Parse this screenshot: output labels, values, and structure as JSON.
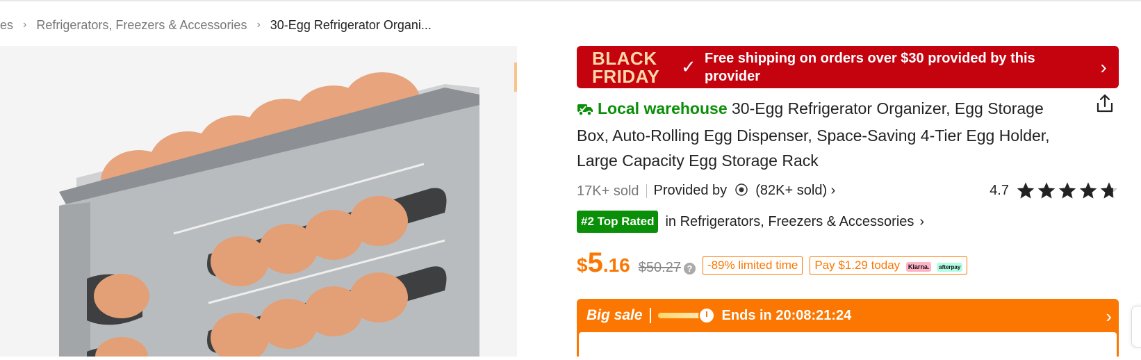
{
  "breadcrumb": {
    "items": [
      "es",
      "Refrigerators, Freezers & Accessories",
      "30-Egg Refrigerator Organi..."
    ],
    "separator": "›"
  },
  "banner": {
    "logo_line1": "BLACK",
    "logo_line2": "FRIDAY",
    "check": "✓",
    "text": "Free shipping on orders over $30 provided by this provider",
    "chevron": "›",
    "color": "#c4030f"
  },
  "product": {
    "local_warehouse": "Local warehouse",
    "title": "30-Egg Refrigerator Organizer, Egg Storage Box, Auto-Rolling Egg Dispenser, Space-Saving 4-Tier Egg Holder, Large Capacity Egg Storage Rack",
    "sold": "17K+ sold",
    "provided_by": "Provided by",
    "provider_sold": "(82K+ sold)",
    "provider_chevron": "›",
    "rating": "4.7",
    "stars": 4.7
  },
  "rank": {
    "badge": "#2 Top Rated",
    "text": "in Refrigerators, Freezers & Accessories",
    "chevron": "›"
  },
  "price": {
    "currency": "$",
    "integer": "5",
    "decimal": ".16",
    "original": "$50.27",
    "help_icon": "?",
    "discount_tag": "-89% limited time",
    "pay_tag": "Pay $1.29 today",
    "klarna": "Klarna.",
    "afterpay": "afterpay",
    "accent_color": "#fb7701"
  },
  "sale": {
    "title": "Big sale",
    "ends": "Ends in 20:08:21:24",
    "chevron": "›"
  },
  "icons": {
    "truck": "truck-icon",
    "share": "share-icon",
    "star": "star-icon",
    "provider": "provider-logo-icon",
    "clock": "clock-icon"
  }
}
